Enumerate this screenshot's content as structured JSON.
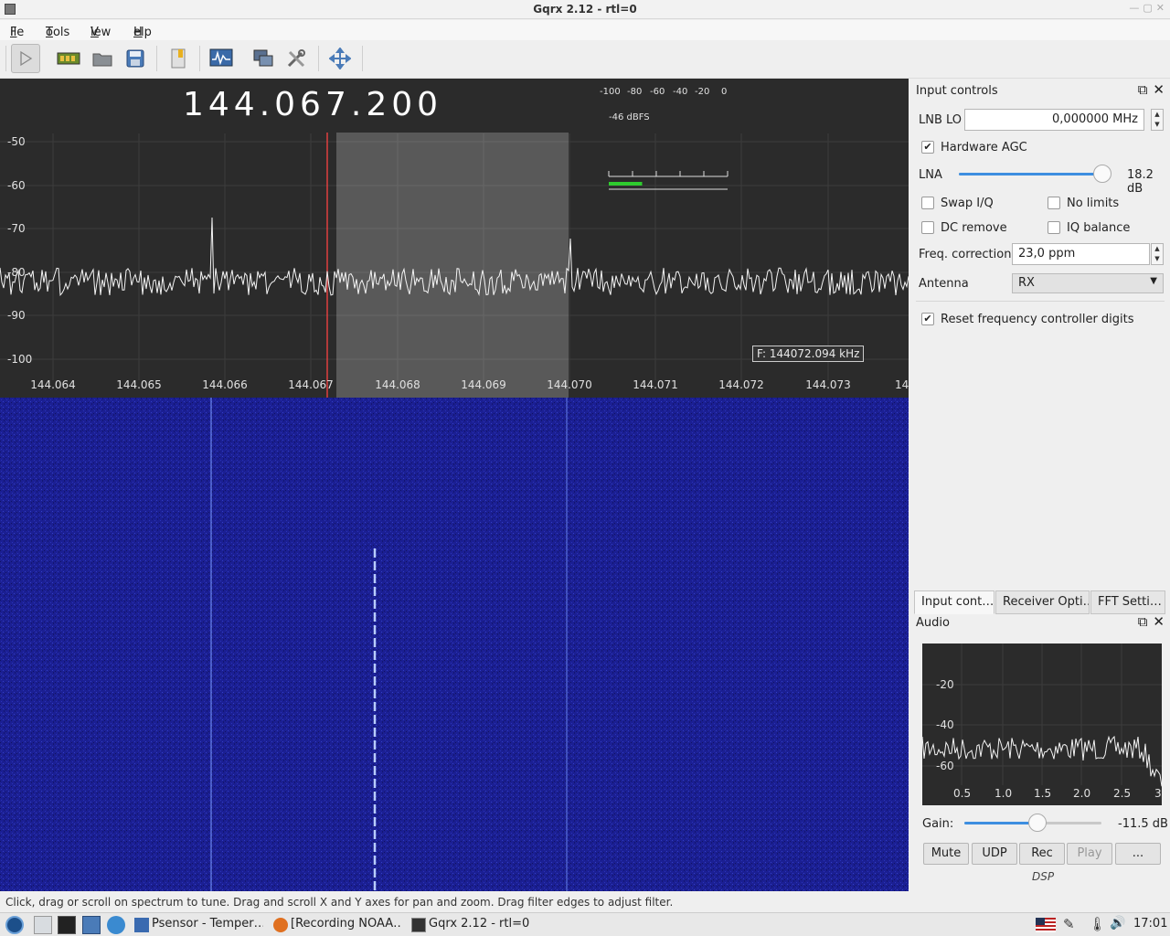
{
  "window": {
    "title": "Gqrx 2.12 - rtl=0"
  },
  "menu": {
    "file": {
      "mnemonic": "F",
      "rest": "ile"
    },
    "tools": {
      "mnemonic": "T",
      "rest": "ools"
    },
    "view": {
      "mnemonic": "V",
      "rest": "iew"
    },
    "help": {
      "mnemonic": "H",
      "rest": "elp"
    }
  },
  "toolbar": {
    "icons": [
      "play-icon",
      "hardware-icon",
      "open-folder-icon",
      "save-icon",
      "bookmark-icon",
      "waveform-icon",
      "remote-control-icon",
      "settings-icon",
      "fit-view-icon"
    ]
  },
  "spectrum": {
    "frequency": "144.067.200",
    "meter": {
      "scale": [
        "-100",
        "-80",
        "-60",
        "-40",
        "-20",
        "0"
      ],
      "reading": "-46 dBFS"
    },
    "tooltip": "F: 144072.094 kHz",
    "ylabels": [
      "-50",
      "-60",
      "-70",
      "-80",
      "-90",
      "-100"
    ],
    "xlabels": [
      "144.064",
      "144.065",
      "144.066",
      "144.067",
      "144.068",
      "144.069",
      "144.070",
      "144.071",
      "144.072",
      "144.073",
      "14"
    ]
  },
  "input_controls": {
    "title": "Input controls",
    "lnb_lo_label": "LNB LO",
    "lnb_lo_value": "0,000000 MHz",
    "hardware_agc_label": "Hardware AGC",
    "hardware_agc_checked": true,
    "lna_label": "LNA",
    "lna_value": "18.2 dB",
    "lna_level": 0.98,
    "swap_iq_label": "Swap I/Q",
    "no_limits_label": "No limits",
    "dc_remove_label": "DC remove",
    "iq_balance_label": "IQ balance",
    "freq_corr_label": "Freq. correction",
    "freq_corr_value": "23,0 ppm",
    "antenna_label": "Antenna",
    "antenna_value": "RX",
    "reset_digits_label": "Reset frequency controller digits",
    "reset_digits_checked": true
  },
  "tabs": [
    "Input cont…",
    "Receiver Opti…",
    "FFT Setti…"
  ],
  "audio": {
    "title": "Audio",
    "ylabels": [
      "-20",
      "-40",
      "-60"
    ],
    "xlabels": [
      "0.5",
      "1.0",
      "1.5",
      "2.0",
      "2.5",
      "3"
    ],
    "gain_label": "Gain:",
    "gain_value": "-11.5 dB",
    "gain_level": 0.53,
    "buttons": {
      "mute": "Mute",
      "udp": "UDP",
      "rec": "Rec",
      "play": "Play",
      "more": "..."
    },
    "dsp_label": "DSP"
  },
  "status": "Click, drag or scroll on spectrum to tune. Drag and scroll X and Y axes for pan and zoom. Drag filter edges to adjust filter.",
  "taskbar": {
    "items": [
      "Psensor - Temper…",
      "[Recording NOAA…",
      "Gqrx 2.12 - rtl=0"
    ],
    "clock": "17:01"
  },
  "colors": {
    "waterfall": "#1b1f93",
    "spectrum_bg": "#2b2b2b",
    "meter_fill": "#2ecc2e",
    "tuning_line": "#e04040",
    "slider_fill": "#3d8ee0"
  }
}
